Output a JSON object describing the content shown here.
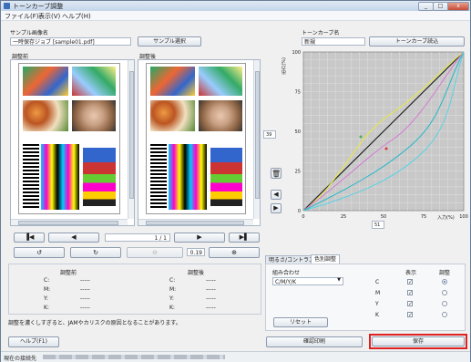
{
  "window": {
    "title": "トーンカーブ調整",
    "min": "_",
    "max": "□",
    "close": "x"
  },
  "menu": {
    "file": "ファイル(F)",
    "view": "表示(V)",
    "help": "ヘルプ(H)"
  },
  "sample": {
    "label": "サンプル画像名",
    "value": "一時保存ジョブ [sample01.pdf]",
    "select_button": "サンプル選択"
  },
  "tone": {
    "label": "トーンカーブ名",
    "value": "新規",
    "load_button": "トーンカーブ読込"
  },
  "preview": {
    "before_label": "調整前",
    "after_label": "調整後",
    "page": "1 / 1",
    "zoom": "0.19"
  },
  "graph": {
    "ylabel": "出力(%)",
    "xlabel": "入力(%)",
    "xticks": [
      "0",
      "25",
      "50",
      "75",
      "100"
    ],
    "yticks": [
      "0",
      "25",
      "50",
      "75",
      "100"
    ],
    "input_value": "51",
    "output_value": "39"
  },
  "values": {
    "before_title": "調整前",
    "after_title": "調整後",
    "rows": [
      {
        "ch": "C:",
        "before": "-----",
        "after": "-----"
      },
      {
        "ch": "M:",
        "before": "-----",
        "after": "-----"
      },
      {
        "ch": "Y:",
        "before": "-----",
        "after": "-----"
      },
      {
        "ch": "K:",
        "before": "-----",
        "after": "-----"
      }
    ],
    "warning": "調整を濃くしすぎると、JAMやカリスクの原因となることがあります。"
  },
  "tabs": {
    "brightness": "明るさ/コントラスト",
    "color": "色別調整"
  },
  "color_adjust": {
    "combo_label": "組み合わせ",
    "combo_value": "C/M/Y/K",
    "show_header": "表示",
    "adjust_header": "調整",
    "channels": [
      {
        "name": "C",
        "show": true,
        "adjust": true
      },
      {
        "name": "M",
        "show": true,
        "adjust": false
      },
      {
        "name": "Y",
        "show": true,
        "adjust": false
      },
      {
        "name": "K",
        "show": true,
        "adjust": false
      }
    ],
    "reset_button": "リセット"
  },
  "footer": {
    "help_button": "ヘルプ(F1)",
    "print_button": "確認印刷",
    "save_button": "保存"
  },
  "status": {
    "connection_label": "現在の接続先"
  }
}
